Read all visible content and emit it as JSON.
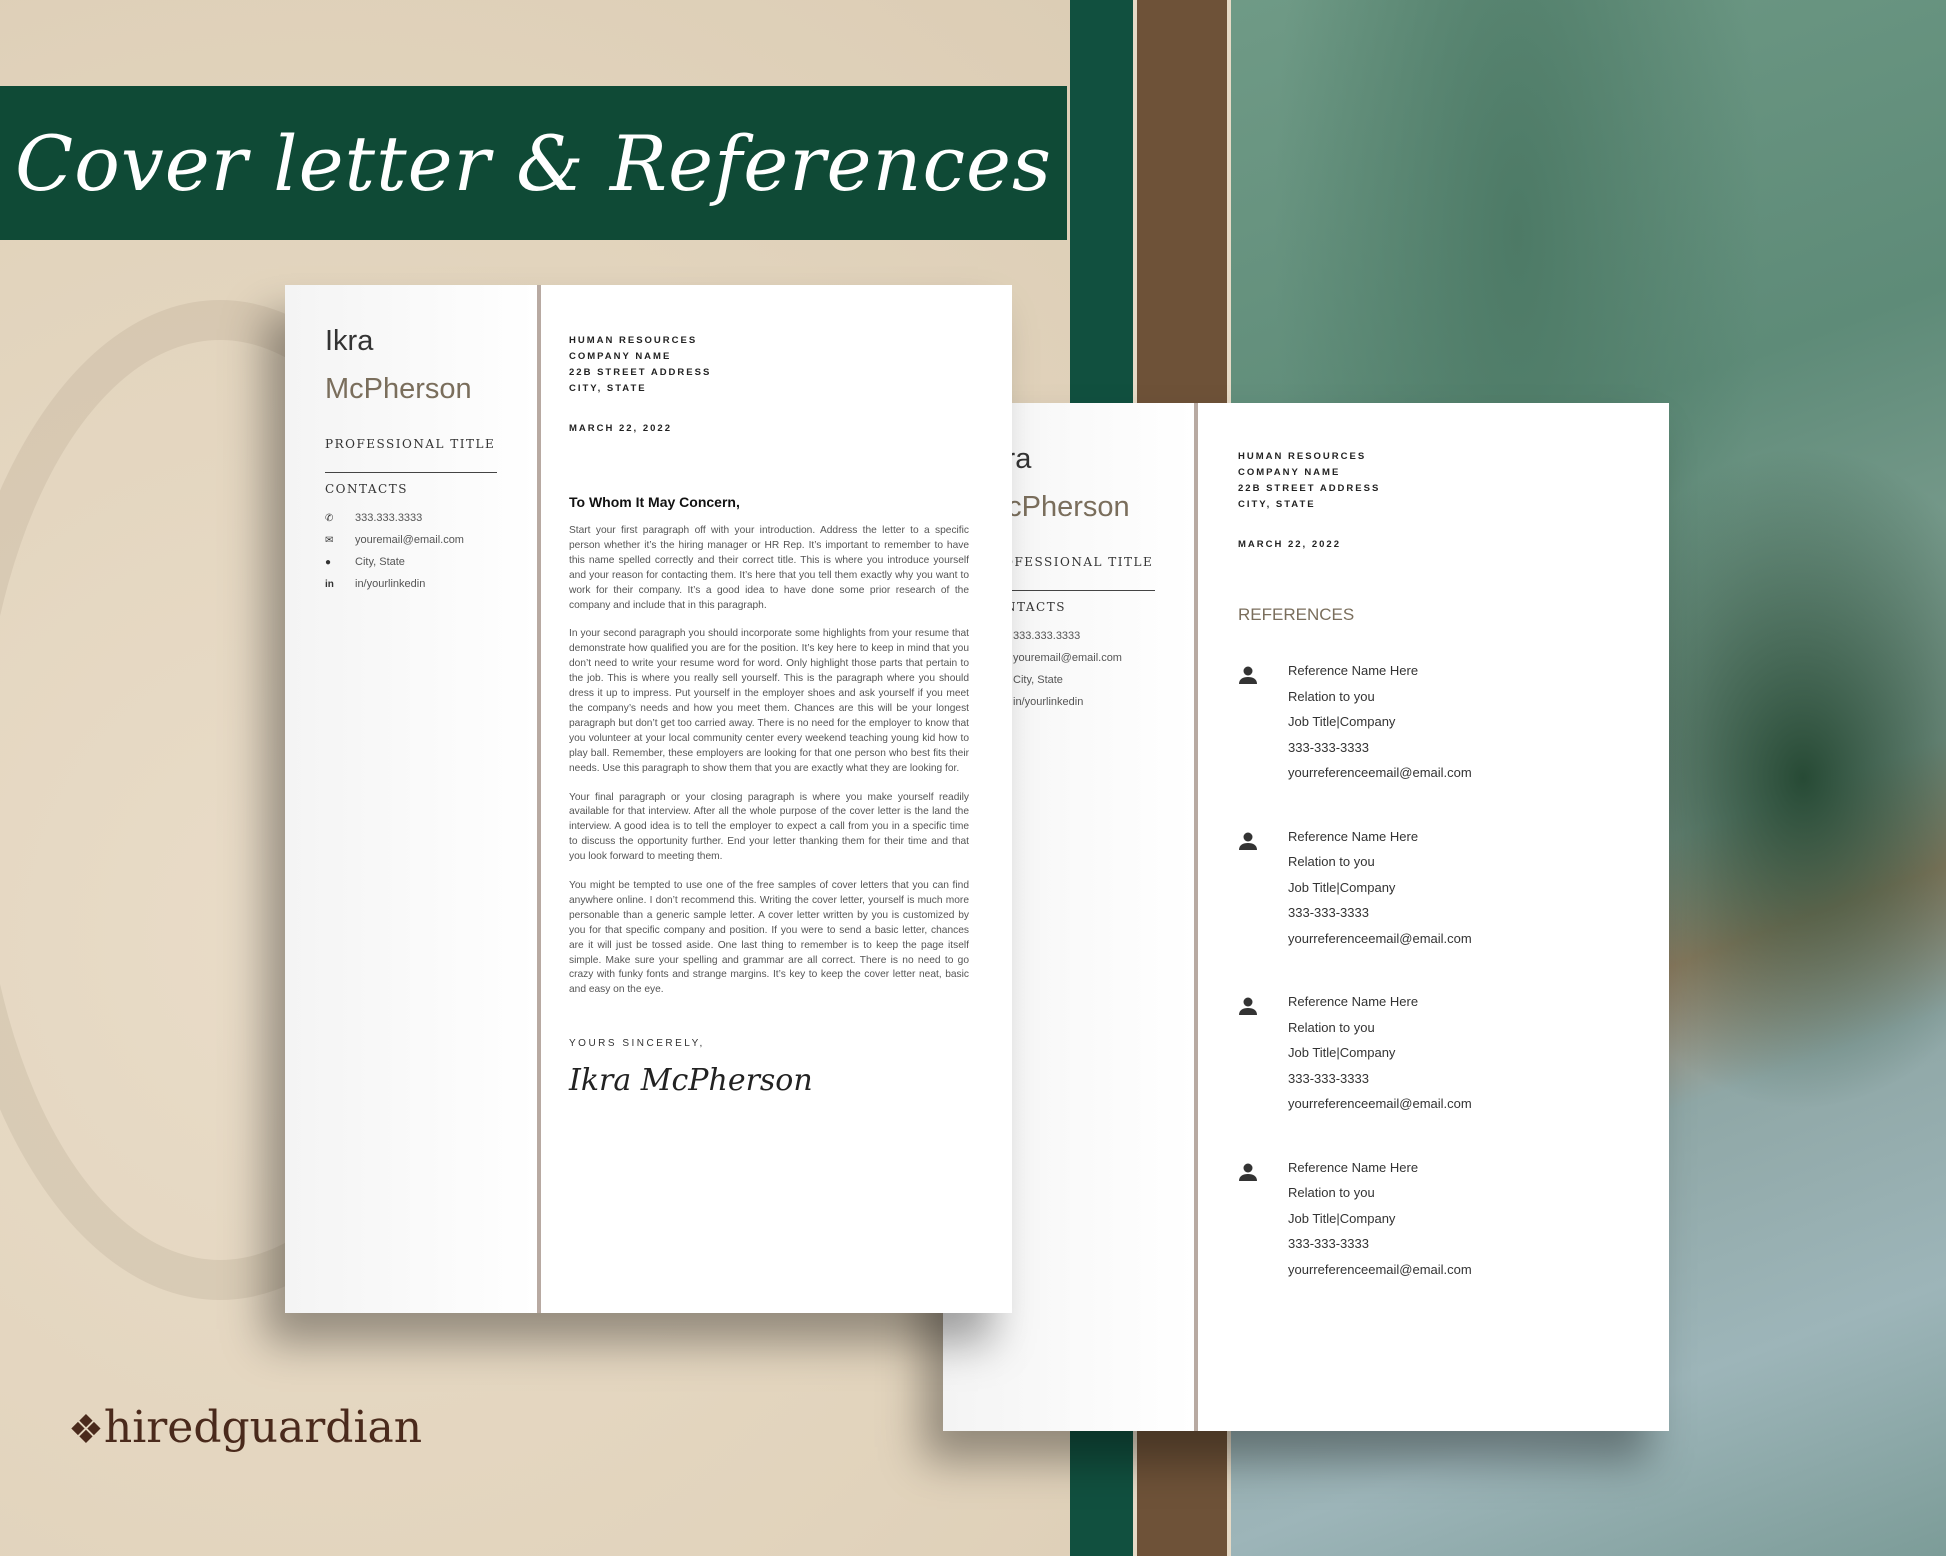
{
  "banner": {
    "title": "Cover letter & References"
  },
  "brand": {
    "logo": "hiredguardian"
  },
  "colors": {
    "banner_green": "#0f4a36",
    "accent_taupe": "#7a6e5c",
    "brown": "#6e5238"
  },
  "profile": {
    "first_name": "Ikra",
    "last_name": "McPherson",
    "title": "PROFESSIONAL TITLE",
    "contacts_heading": "CONTACTS",
    "contacts": [
      {
        "icon": "phone-icon",
        "value": "333.333.3333"
      },
      {
        "icon": "mail-icon",
        "value": "youremail@email.com"
      },
      {
        "icon": "location-icon",
        "value": "City, State"
      },
      {
        "icon": "linkedin-icon",
        "value": "in/yourlinkedin"
      }
    ]
  },
  "address": [
    "HUMAN RESOURCES",
    "COMPANY NAME",
    "22B STREET ADDRESS",
    "CITY, STATE"
  ],
  "date": "MARCH 22, 2022",
  "letter": {
    "greeting": "To Whom It May Concern,",
    "paragraphs": [
      "Start your first paragraph off with your introduction. Address the letter to a specific person whether it’s the hiring manager or HR Rep. It’s important to remember to have this name spelled correctly and their correct title. This is where you introduce yourself and your reason for contacting them. It’s here that you tell them exactly why you want to work for their company. It’s a good idea to have done some prior research of the company and include that in this paragraph.",
      "In your second paragraph you should incorporate some highlights from your resume that demonstrate how qualified you are for the position. It’s key here to keep in mind that you don’t need to write your resume word for word. Only highlight those parts that pertain to the job. This is where you really sell yourself. This is the paragraph where you should dress it up to impress. Put yourself in the employer shoes and ask yourself if you meet the company’s needs and how you meet them. Chances are this will be your longest paragraph but don’t get too carried away. There is no need for the employer to know that you volunteer at your local community center every weekend teaching young kid how to play ball. Remember, these employers are looking for that one person who best fits their needs. Use this paragraph to show them that you are exactly what they are looking for.",
      "Your final paragraph or your closing paragraph is where you make yourself readily available for that interview. After all the whole purpose of the cover letter is the land the interview. A good idea is to tell the employer to expect a call from you in a specific time to discuss the opportunity further. End your letter thanking them for their time and that you look forward to meeting them.",
      "You might be tempted to use one of the free samples of cover letters that you can find anywhere online. I don’t recommend this. Writing the cover letter, yourself is much more personable than a generic sample letter. A cover letter written by you is customized by you for that specific company and position. If you were to send a basic letter, chances are it will just be tossed aside. One last thing to remember is to keep the page itself simple. Make sure your spelling and grammar are all correct. There is no need to go crazy with funky fonts and strange margins. It’s key to keep the cover letter neat, basic and easy on the eye."
    ],
    "closing": "YOURS SINCERELY,",
    "signature": "Ikra McPherson"
  },
  "references": {
    "heading": "REFERENCES",
    "items": [
      {
        "name": "Reference Name Here",
        "relation": "Relation to you",
        "job": "Job Title|Company",
        "phone": "333-333-3333",
        "email": "yourreferenceemail@email.com"
      },
      {
        "name": "Reference Name Here",
        "relation": "Relation to you",
        "job": "Job Title|Company",
        "phone": "333-333-3333",
        "email": "yourreferenceemail@email.com"
      },
      {
        "name": "Reference Name Here",
        "relation": "Relation to you",
        "job": "Job Title|Company",
        "phone": "333-333-3333",
        "email": "yourreferenceemail@email.com"
      },
      {
        "name": "Reference Name Here",
        "relation": "Relation to you",
        "job": "Job Title|Company",
        "phone": "333-333-3333",
        "email": "yourreferenceemail@email.com"
      }
    ]
  }
}
